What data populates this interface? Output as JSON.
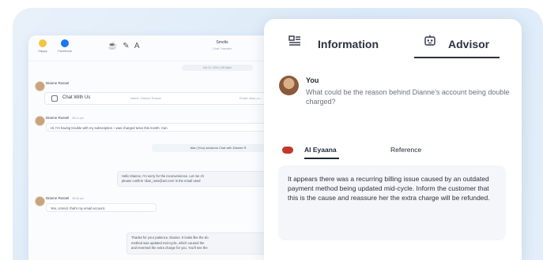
{
  "chat": {
    "apps": [
      {
        "label": "Happy",
        "icon": "emoji-icon"
      },
      {
        "label": "Facebook",
        "icon": "facebook-icon"
      }
    ],
    "toolbar_icons": "☕ ✎ A",
    "contact_name": "Smolts",
    "contact_subtitle": "Chat Transfer",
    "date_pill": "Oct 21, 2024 | 08:15pm",
    "first_sender": "Dianne Russel",
    "chat_card": {
      "label": "Chat With Us",
      "name": "Name: Dianne Russel",
      "email": "Email: dian_ru..."
    },
    "messages": [
      {
        "sender": "Dianne Russel",
        "time": "08:41 pm",
        "text": "Hi, I'm having trouble with my subscription. I was charged twice this month. Can"
      },
      {
        "text": "Alan (You) sessions Chat with Dianne R"
      },
      {
        "text": "Hello Dianne, I'm sorry for the inconvenience. Let me ch",
        "text2": "please confirm 'dian_russ@acl.com' is the email used"
      },
      {
        "sender": "Dianne Russel",
        "time": "08:46 pm",
        "text": "Yes, correct. that's my email account."
      },
      {
        "text": "Thanks for your patience, Dianne. It looks like the do",
        "text2": "method was updated mid-cycle, which caused the",
        "text3": "and reversed the extra charge for you. You'll see the"
      }
    ]
  },
  "panel": {
    "tabs": [
      {
        "label": "Information",
        "icon": "info-list-icon"
      },
      {
        "label": "Advisor",
        "icon": "robot-icon"
      }
    ],
    "you_label": "You",
    "question": "What could be the reason behind Dianne's account being double charged?",
    "subtabs": [
      "AI Eyaana",
      "Reference"
    ],
    "answer": "It appears there was a recurring billing issue caused by an outdated payment method being updated mid-cycle. Inform the customer that this is the cause and reassure her the extra charge will be refunded."
  },
  "colors": {
    "backdrop": "#dcebf8",
    "panel": "#ffffff",
    "accent_red": "#c0392b",
    "text_dark": "#2d3142"
  }
}
